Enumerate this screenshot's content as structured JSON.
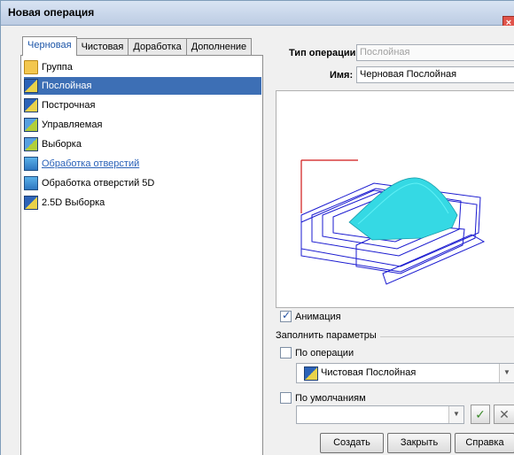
{
  "window": {
    "title": "Новая операция",
    "close_glyph": "×"
  },
  "tabs": [
    {
      "label": "Черновая",
      "active": true
    },
    {
      "label": "Чистовая",
      "active": false
    },
    {
      "label": "Доработка",
      "active": false
    },
    {
      "label": "Дополнение",
      "active": false
    }
  ],
  "operations": [
    {
      "label": "Группа",
      "icon": "folder-icon",
      "selected": false
    },
    {
      "label": "Послойная",
      "icon": "layer-operation-icon",
      "selected": true
    },
    {
      "label": "Построчная",
      "icon": "line-operation-icon",
      "selected": false
    },
    {
      "label": "Управляемая",
      "icon": "guided-operation-icon",
      "selected": false
    },
    {
      "label": "Выборка",
      "icon": "pocket-operation-icon",
      "selected": false
    },
    {
      "label": "Обработка отверстий",
      "icon": "drilling-icon",
      "selected": false
    },
    {
      "label": "Обработка отверстий 5D",
      "icon": "drilling-5d-icon",
      "selected": false
    },
    {
      "label": "2.5D Выборка",
      "icon": "pocket-2-5d-icon",
      "selected": false
    }
  ],
  "fields": {
    "type_label": "Тип операции:",
    "type_value": "Послойная",
    "name_label": "Имя:",
    "name_value": "Черновая Послойная"
  },
  "animation": {
    "label": "Анимация",
    "checked": true
  },
  "fill_params": {
    "group_title": "Заполнить параметры",
    "by_operation_label": "По операции",
    "by_operation_checked": false,
    "operation_value": "Чистовая Послойная",
    "by_default_label": "По умолчаниям",
    "by_default_checked": false,
    "default_value": ""
  },
  "buttons": {
    "create": "Создать",
    "close": "Закрыть",
    "help": "Справка"
  },
  "colors": {
    "selection": "#3d6fb5",
    "toolpath": "#1a1ad0",
    "surface": "#33d6e0",
    "link": "#2a62b8"
  }
}
